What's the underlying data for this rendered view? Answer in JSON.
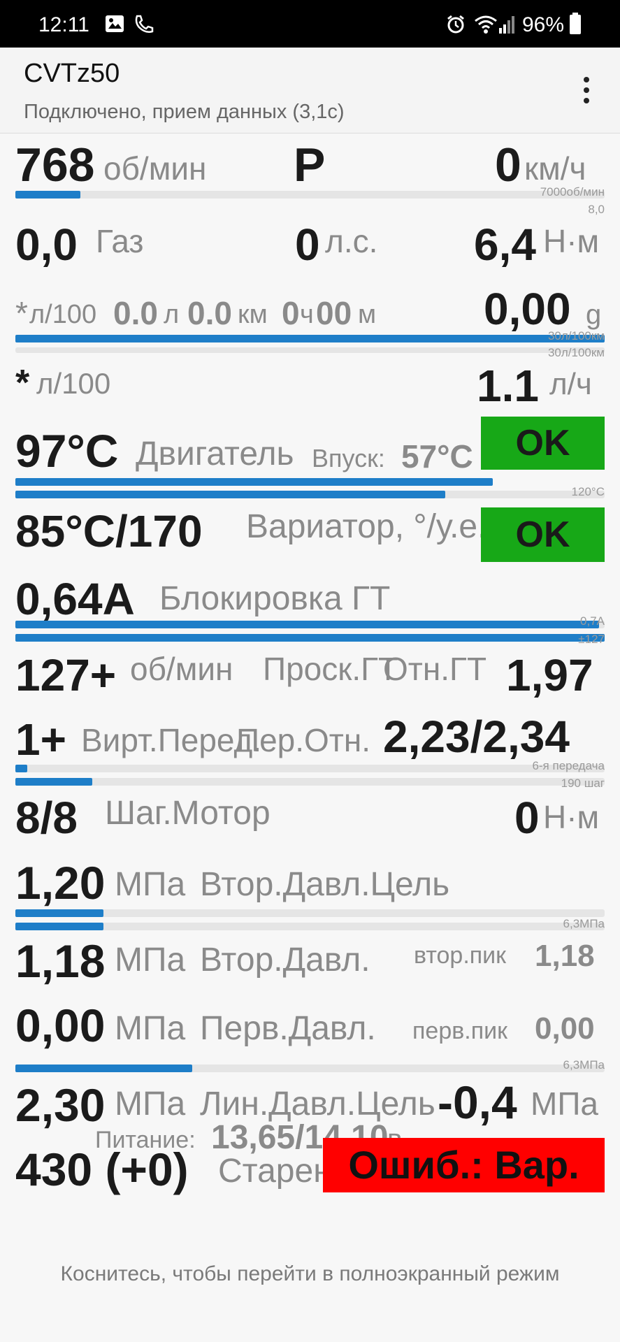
{
  "status_bar": {
    "time": "12:11",
    "battery": "96%"
  },
  "app": {
    "title": "CVTz50",
    "subtitle": "Подключено, прием данных (3,1с)"
  },
  "engine": {
    "rpm": "768",
    "rpm_unit": "об/мин",
    "gear": "P",
    "speed": "0",
    "speed_unit": "км/ч",
    "rpm_scale": "7000об/мин",
    "rpm_fraction": 0.11,
    "scale_small": "8,0"
  },
  "throttle": {
    "value": "0,0",
    "label": "Газ",
    "hp": "0",
    "hp_unit": "л.с.",
    "torque": "6,4",
    "torque_unit": "Н·м"
  },
  "fuel_trip": {
    "star": "*",
    "unit": "л/100",
    "liters": "0.0",
    "liters_unit": "л",
    "km": "0.0",
    "km_unit": "км",
    "hours": "0",
    "hours_unit": "ч",
    "minutes": "00",
    "minutes_unit": "м",
    "g_value": "0,00",
    "g_unit": "g",
    "scale1": "30л/100км",
    "scale2": "30л/100км",
    "bar_fraction": 1.0
  },
  "fuel_inst": {
    "star": "*",
    "unit": "л/100",
    "rate": "1.1",
    "rate_unit": "л/ч"
  },
  "engine_temp": {
    "value": "97°C",
    "label": "Двигатель",
    "intake_label": "Впуск:",
    "intake_value": "57°C",
    "status": "OK",
    "scale": "120°C",
    "bar1_fraction": 0.81,
    "bar2_fraction": 0.73
  },
  "cvt_temp": {
    "value": "85°C/170",
    "label": "Вариатор, °/у.е.",
    "status": "OK"
  },
  "lockup": {
    "value": "0,64A",
    "label": "Блокировка ГТ",
    "scale1": "0,7A",
    "scale2": "±127",
    "bar1_fraction": 0.99,
    "bar2_fraction": 1.0
  },
  "slip": {
    "value": "127+",
    "unit": "об/мин",
    "label": "Проск.ГТ",
    "ratio_label": "Отн.ГТ",
    "ratio_value": "1,97"
  },
  "virt_gear": {
    "value": "1+",
    "label": "Вирт.Перед.",
    "ratio_label": "Пер.Отн.",
    "ratio_value": "2,23/2,34",
    "scale1": "6-я передача",
    "scale2": "190 шаг",
    "bar1_fraction": 0.02,
    "bar2_fraction": 0.13
  },
  "stepper": {
    "value": "8/8",
    "label": "Шаг.Мотор",
    "torque": "0",
    "torque_unit": "Н·м"
  },
  "sec_target": {
    "value": "1,20",
    "unit": "МПа",
    "label": "Втор.Давл.Цель",
    "scale": "6,3МПа",
    "bar1_fraction": 0.15,
    "bar2_fraction": 0.15
  },
  "sec_press": {
    "value": "1,18",
    "unit": "МПа",
    "label": "Втор.Давл.",
    "peak_label": "втор.пик",
    "peak_value": "1,18"
  },
  "pri_press": {
    "value": "0,00",
    "unit": "МПа",
    "label": "Перв.Давл.",
    "peak_label": "перв.пик",
    "peak_value": "0,00",
    "scale": "6,3МПа",
    "bar_fraction": 0.3
  },
  "line_press": {
    "value": "2,30",
    "unit": "МПа",
    "label": "Лин.Давл.Цель",
    "right_value": "-0,4",
    "right_unit": "МПа"
  },
  "power": {
    "label": "Питание:",
    "value": "13,65/14,10",
    "unit": "в"
  },
  "aging": {
    "value": "430 (+0)",
    "label": "Старение",
    "error": "Ошиб.: Вар."
  },
  "hint": "Коснитесь, чтобы перейти в полноэкранный режим"
}
